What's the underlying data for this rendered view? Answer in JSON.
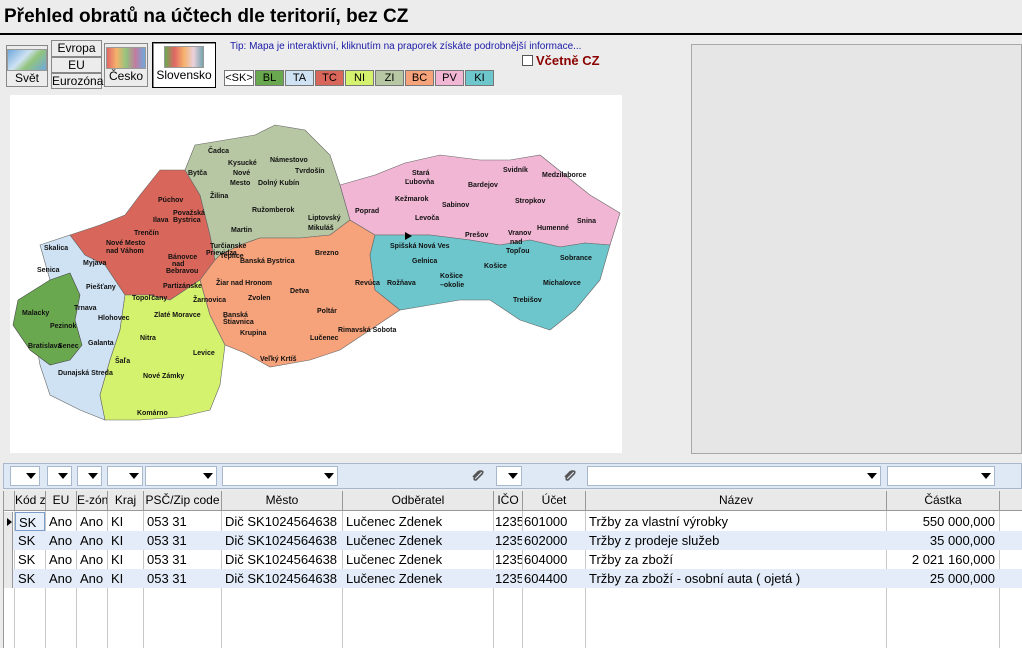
{
  "title": "Přehled obratů na účtech dle teritorií, bez CZ",
  "region_buttons": {
    "svet": "Svět",
    "evropa": "Evropa",
    "eu": "EU",
    "eurozona": "Eurozóna",
    "cesko": "Česko",
    "slovensko": "Slovensko"
  },
  "tip": "Tip: Mapa je interaktivní, kliknutím na praporek získáte podrobnější informace...",
  "include_cz": {
    "label": "Včetně CZ",
    "checked": false
  },
  "kraj_tabs": [
    {
      "label": "<SK>",
      "color": "#ffffff"
    },
    {
      "label": "BL",
      "color": "#6aa84f"
    },
    {
      "label": "TA",
      "color": "#cfe2f3"
    },
    {
      "label": "TC",
      "color": "#d9665a"
    },
    {
      "label": "NI",
      "color": "#d5f26e"
    },
    {
      "label": "ZI",
      "color": "#b7c7a3"
    },
    {
      "label": "BC",
      "color": "#f6a27a"
    },
    {
      "label": "PV",
      "color": "#f1b6d4"
    },
    {
      "label": "KI",
      "color": "#6cc6cc"
    }
  ],
  "map": {
    "labels": {
      "cadca": "Čadca",
      "kysucke": "Kysucké",
      "nove_mesto": "Nové",
      "mesto": "Mesto",
      "namestovo": "Námestovo",
      "tvrdosin": "Tvrdošín",
      "bytca": "Bytča",
      "zilina": "Žilina",
      "dolny_kubin": "Dolný Kubín",
      "ruzomberok": "Ružomberok",
      "martin": "Martin",
      "liptovsky": "Liptovský",
      "mikulas": "Mikuláš",
      "puchov": "Púchov",
      "povazska": "Považská",
      "bystrica": "Bystrica",
      "ilava": "Ilava",
      "trencin": "Trenčín",
      "nove_mesto_vah": "Nové Mesto",
      "nad_vahom": "nad Váhom",
      "myjava": "Myjava",
      "banovce": "Bánovce",
      "nad": "nad",
      "bebravou": "Bebravou",
      "prievidza": "Prievidza",
      "partizanske": "Partizánske",
      "turcianske": "Turčianske",
      "teplice": "Teplice",
      "skalica": "Skalica",
      "senica": "Senica",
      "piestany": "Piešťany",
      "trnava": "Trnava",
      "hlohovec": "Hlohovec",
      "galanta": "Galanta",
      "dunajska": "Dunajská Streda",
      "malacky": "Malacky",
      "pezinok": "Pezinok",
      "bratislava": "Bratislava",
      "senec": "Senec",
      "topolcany": "Topoľčany",
      "zlate_moravce": "Zlaté Moravce",
      "nitra": "Nitra",
      "sala": "Šaľa",
      "nove_zamky": "Nové Zámky",
      "levice": "Levice",
      "komarno": "Komárno",
      "zarnovica": "Žarnovica",
      "ziar": "Žiar nad Hronom",
      "zvolen": "Zvolen",
      "banska_bystrica": "Banská Bystrica",
      "brezno": "Brezno",
      "detva": "Detva",
      "banska": "Banská",
      "stiavnica": "Štiavnica",
      "krupina": "Krupina",
      "poltar": "Poltár",
      "lucenec": "Lučenec",
      "velky_krtis": "Veľký Krtíš",
      "rimavska_sobota": "Rimavská Sobota",
      "revuca": "Revúca",
      "stara": "Stará",
      "lubovna": "Ľubovňa",
      "kezmarok": "Kežmarok",
      "poprad": "Poprad",
      "levoca": "Levoča",
      "bardejov": "Bardejov",
      "sabinov": "Sabinov",
      "svidnik": "Svidník",
      "stropkov": "Stropkov",
      "medzilaborce": "Medzilaborce",
      "presov": "Prešov",
      "humenne": "Humenné",
      "snina": "Snina",
      "vranov": "Vranov",
      "nad2": "nad",
      "toplou": "Topľou",
      "spisska": "Spišská Nová Ves",
      "gelnica": "Gelnica",
      "roznava": "Rožňava",
      "kosice_okolie": "Košice",
      "okolie": "–okolie",
      "kosice": "Košice",
      "sobrance": "Sobrance",
      "michalovce": "Michalovce",
      "trebisov": "Trebišov"
    }
  },
  "grid": {
    "headers": [
      "Kód z",
      "EU",
      "E-zón",
      "Kraj",
      "PSČ/Zip code",
      "Město",
      "Odběratel",
      "IČO",
      "Účet",
      "Název",
      "Částka"
    ],
    "rows": [
      [
        "SK",
        "Ano",
        "Ano",
        "KI",
        "053 31",
        "Dič SK1024564638",
        "Lučenec Zdenek",
        "1235",
        "601000",
        "Tržby za vlastní výrobky",
        "550 000,000"
      ],
      [
        "SK",
        "Ano",
        "Ano",
        "KI",
        "053 31",
        "Dič SK1024564638",
        "Lučenec Zdenek",
        "1235",
        "602000",
        "Tržby z prodeje služeb",
        "35 000,000"
      ],
      [
        "SK",
        "Ano",
        "Ano",
        "KI",
        "053 31",
        "Dič SK1024564638",
        "Lučenec Zdenek",
        "1235",
        "604000",
        "Tržby za zboží",
        "2 021 160,000"
      ],
      [
        "SK",
        "Ano",
        "Ano",
        "KI",
        "053 31",
        "Dič SK1024564638",
        "Lučenec Zdenek",
        "1235",
        "604400",
        "Tržby za zboží - osobní auta ( ojetá )",
        "25 000,000"
      ]
    ]
  }
}
